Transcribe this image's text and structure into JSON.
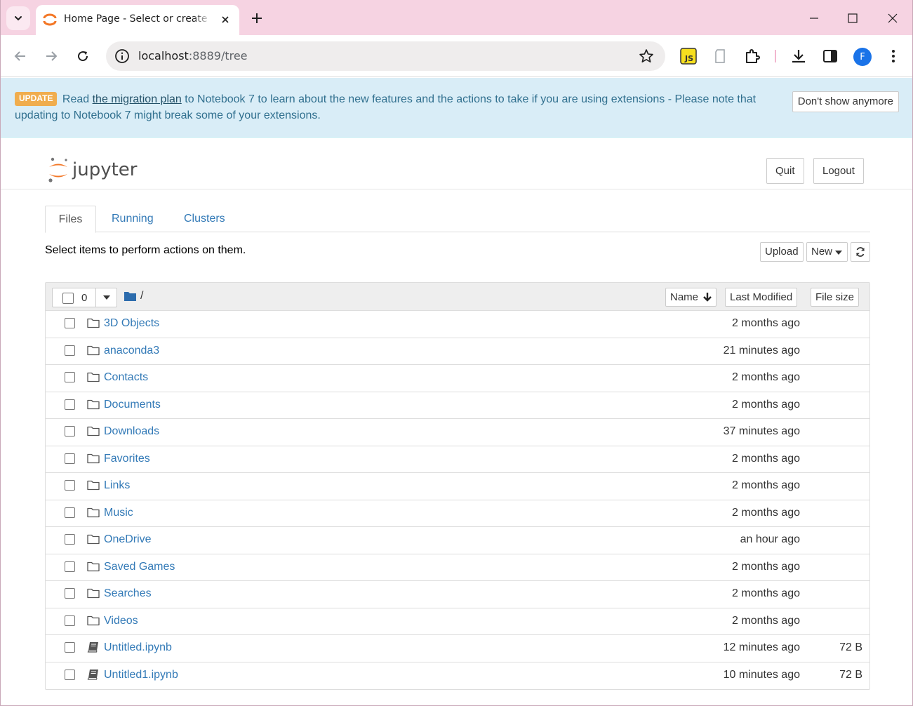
{
  "browser": {
    "tab_title": "Home Page - Select or create a notebook",
    "url_host": "localhost",
    "url_rest": ":8889/tree",
    "profile_initial": "F"
  },
  "banner": {
    "badge": "UPDATE",
    "text_before": "Read",
    "link_text": "the migration plan",
    "text_after": "to Notebook 7 to learn about the new features and the actions to take if you are using extensions - Please note that updating to Notebook 7 might break some of your extensions.",
    "dismiss_label": "Don't show anymore"
  },
  "header": {
    "logo_text": "jupyter",
    "quit_label": "Quit",
    "logout_label": "Logout"
  },
  "tabs": [
    {
      "label": "Files",
      "active": true
    },
    {
      "label": "Running",
      "active": false
    },
    {
      "label": "Clusters",
      "active": false
    }
  ],
  "toolbar": {
    "hint": "Select items to perform actions on them.",
    "upload_label": "Upload",
    "new_label": "New"
  },
  "list_header": {
    "selected_count": "0",
    "path": "/",
    "sort_name": "Name",
    "sort_modified": "Last Modified",
    "sort_size": "File size"
  },
  "files": [
    {
      "name": "3D Objects",
      "type": "folder",
      "modified": "2 months ago",
      "size": ""
    },
    {
      "name": "anaconda3",
      "type": "folder",
      "modified": "21 minutes ago",
      "size": ""
    },
    {
      "name": "Contacts",
      "type": "folder",
      "modified": "2 months ago",
      "size": ""
    },
    {
      "name": "Documents",
      "type": "folder",
      "modified": "2 months ago",
      "size": ""
    },
    {
      "name": "Downloads",
      "type": "folder",
      "modified": "37 minutes ago",
      "size": ""
    },
    {
      "name": "Favorites",
      "type": "folder",
      "modified": "2 months ago",
      "size": ""
    },
    {
      "name": "Links",
      "type": "folder",
      "modified": "2 months ago",
      "size": ""
    },
    {
      "name": "Music",
      "type": "folder",
      "modified": "2 months ago",
      "size": ""
    },
    {
      "name": "OneDrive",
      "type": "folder",
      "modified": "an hour ago",
      "size": ""
    },
    {
      "name": "Saved Games",
      "type": "folder",
      "modified": "2 months ago",
      "size": ""
    },
    {
      "name": "Searches",
      "type": "folder",
      "modified": "2 months ago",
      "size": ""
    },
    {
      "name": "Videos",
      "type": "folder",
      "modified": "2 months ago",
      "size": ""
    },
    {
      "name": "Untitled.ipynb",
      "type": "notebook",
      "modified": "12 minutes ago",
      "size": "72 B"
    },
    {
      "name": "Untitled1.ipynb",
      "type": "notebook",
      "modified": "10 minutes ago",
      "size": "72 B"
    }
  ],
  "colors": {
    "link": "#337ab7",
    "banner_bg": "#d9edf7",
    "badge": "#f0ad4e",
    "jupyter_orange": "#f37726",
    "tabstrip": "#f6d3e2"
  }
}
